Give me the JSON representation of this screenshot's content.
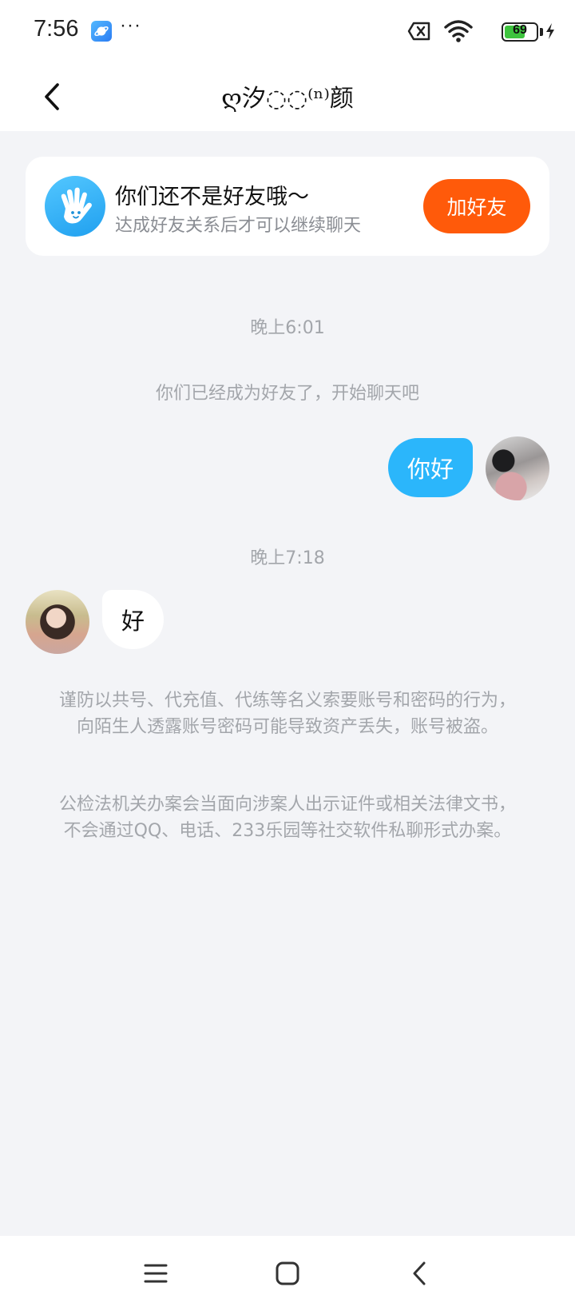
{
  "status_bar": {
    "time": "7:56",
    "more": "···",
    "battery_level": "69",
    "battery_percent": 69,
    "battery_color": "#3ec43e"
  },
  "header": {
    "title": "ღ汐◌◌⁽ⁿ⁾颜",
    "back_icon": "chevron-left-icon"
  },
  "friend_card": {
    "title": "你们还不是好友哦～",
    "subtitle": "达成好友关系后才可以继续聊天",
    "button_label": "加好友",
    "button_color": "#ff5a0a",
    "icon": "wave-hand-icon"
  },
  "chat": {
    "timestamp_1": "晚上6:01",
    "system_notice": "你们已经成为好友了，开始聊天吧",
    "outgoing_message": "你好",
    "outgoing_bubble_color": "#2bb6fb",
    "timestamp_2": "晚上7:18",
    "incoming_message": "好"
  },
  "safety_tips": {
    "tip_1": "谨防以共号、代充值、代练等名义索要账号和密码的行为，向陌生人透露账号密码可能导致资产丢失，账号被盗。",
    "tip_2": "公检法机关办案会当面向涉案人出示证件或相关法律文书，不会通过QQ、电话、233乐园等社交软件私聊形式办案。"
  },
  "nav_bar": {
    "icons": [
      "menu-icon",
      "home-icon",
      "back-icon"
    ]
  }
}
